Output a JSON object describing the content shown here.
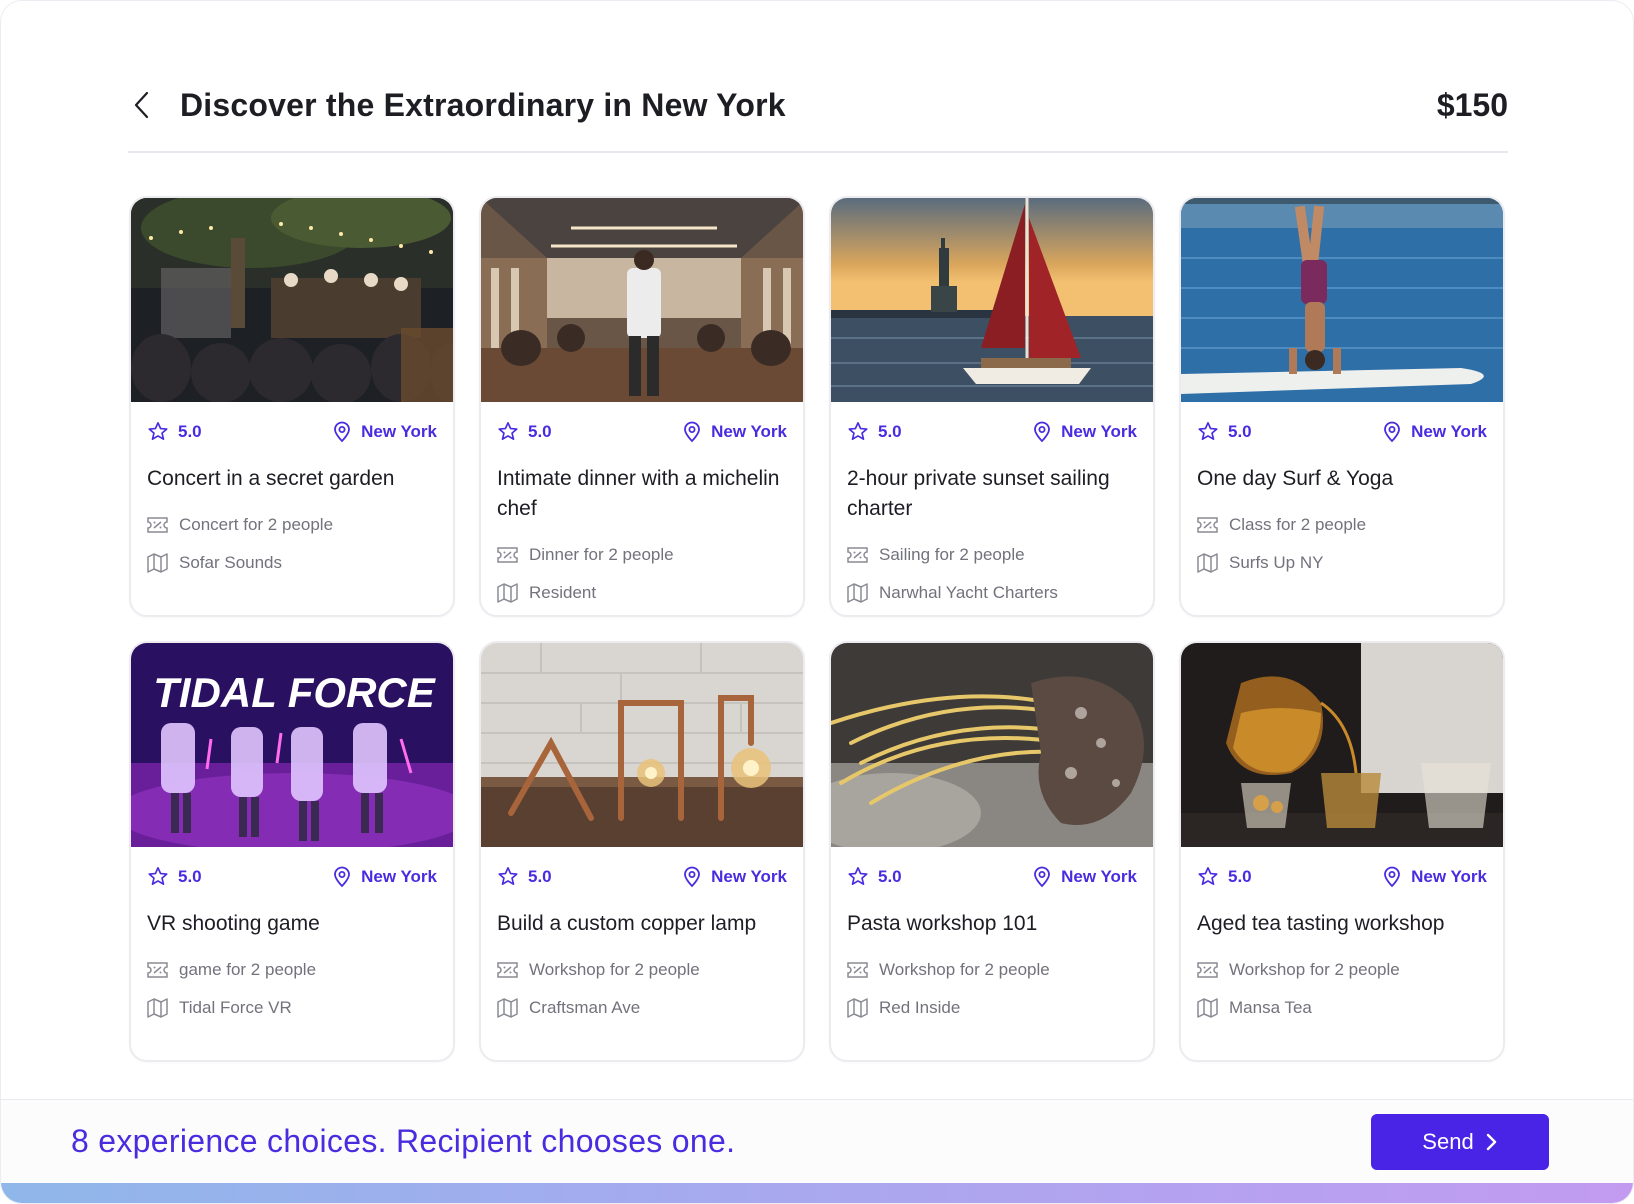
{
  "header": {
    "title": "Discover the Extraordinary in New York",
    "price": "$150"
  },
  "cards": [
    {
      "rating": "5.0",
      "location": "New York",
      "title": "Concert in a secret garden",
      "type": "Concert for 2 people",
      "provider": "Sofar Sounds"
    },
    {
      "rating": "5.0",
      "location": "New York",
      "title": "Intimate dinner with a michelin chef",
      "type": "Dinner for 2 people",
      "provider": "Resident"
    },
    {
      "rating": "5.0",
      "location": "New York",
      "title": "2-hour private sunset sailing charter",
      "type": "Sailing for 2 people",
      "provider": "Narwhal Yacht Charters"
    },
    {
      "rating": "5.0",
      "location": "New York",
      "title": "One day Surf & Yoga",
      "type": "Class for 2 people",
      "provider": "Surfs Up NY"
    },
    {
      "rating": "5.0",
      "location": "New York",
      "title": "VR shooting game",
      "type": "game for 2 people",
      "provider": "Tidal Force VR",
      "image_text": "TIDAL FORCE"
    },
    {
      "rating": "5.0",
      "location": "New York",
      "title": "Build a custom copper lamp",
      "type": "Workshop for 2 people",
      "provider": "Craftsman Ave"
    },
    {
      "rating": "5.0",
      "location": "New York",
      "title": "Pasta workshop 101",
      "type": "Workshop for 2 people",
      "provider": "Red Inside"
    },
    {
      "rating": "5.0",
      "location": "New York",
      "title": "Aged tea tasting workshop",
      "type": "Workshop for 2 people",
      "provider": "Mansa Tea"
    }
  ],
  "footer": {
    "summary": "8 experience choices. Recipient chooses one.",
    "send_label": "Send"
  },
  "icons": {
    "back": "chevron-left-icon",
    "rating": "star-badge-icon",
    "location": "map-pin-icon",
    "ticket": "ticket-icon",
    "provider": "map-icon",
    "send": "chevron-right-icon"
  },
  "colors": {
    "accent": "#4a2ce0",
    "button": "#4a24e6",
    "muted_text": "#72727c"
  }
}
